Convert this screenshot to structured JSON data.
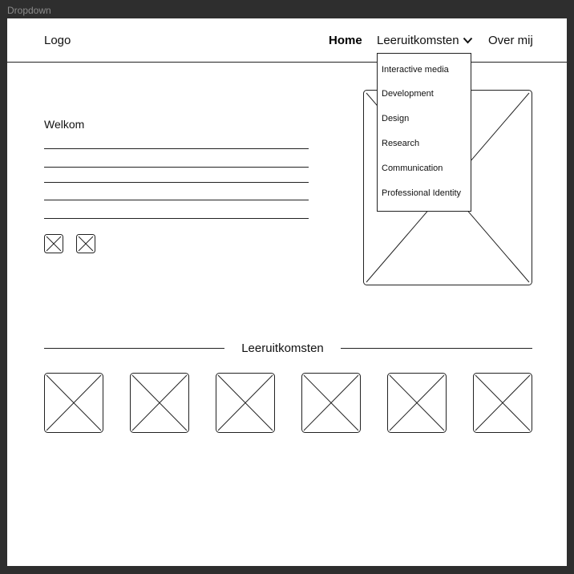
{
  "frame": {
    "label": "Dropdown"
  },
  "nav": {
    "logo": "Logo",
    "home": "Home",
    "dropdown_label": "Leeruitkomsten",
    "about": "Over mij",
    "dropdown_icon": "chevron-down-icon"
  },
  "dropdown": {
    "items": [
      "Interactive media",
      "Development",
      "Design",
      "Research",
      "Communication",
      "Professional Identity"
    ]
  },
  "hero": {
    "title": "Welkom"
  },
  "section": {
    "title": "Leeruitkomsten"
  },
  "icons": {
    "placeholder": "image-placeholder-icon"
  }
}
